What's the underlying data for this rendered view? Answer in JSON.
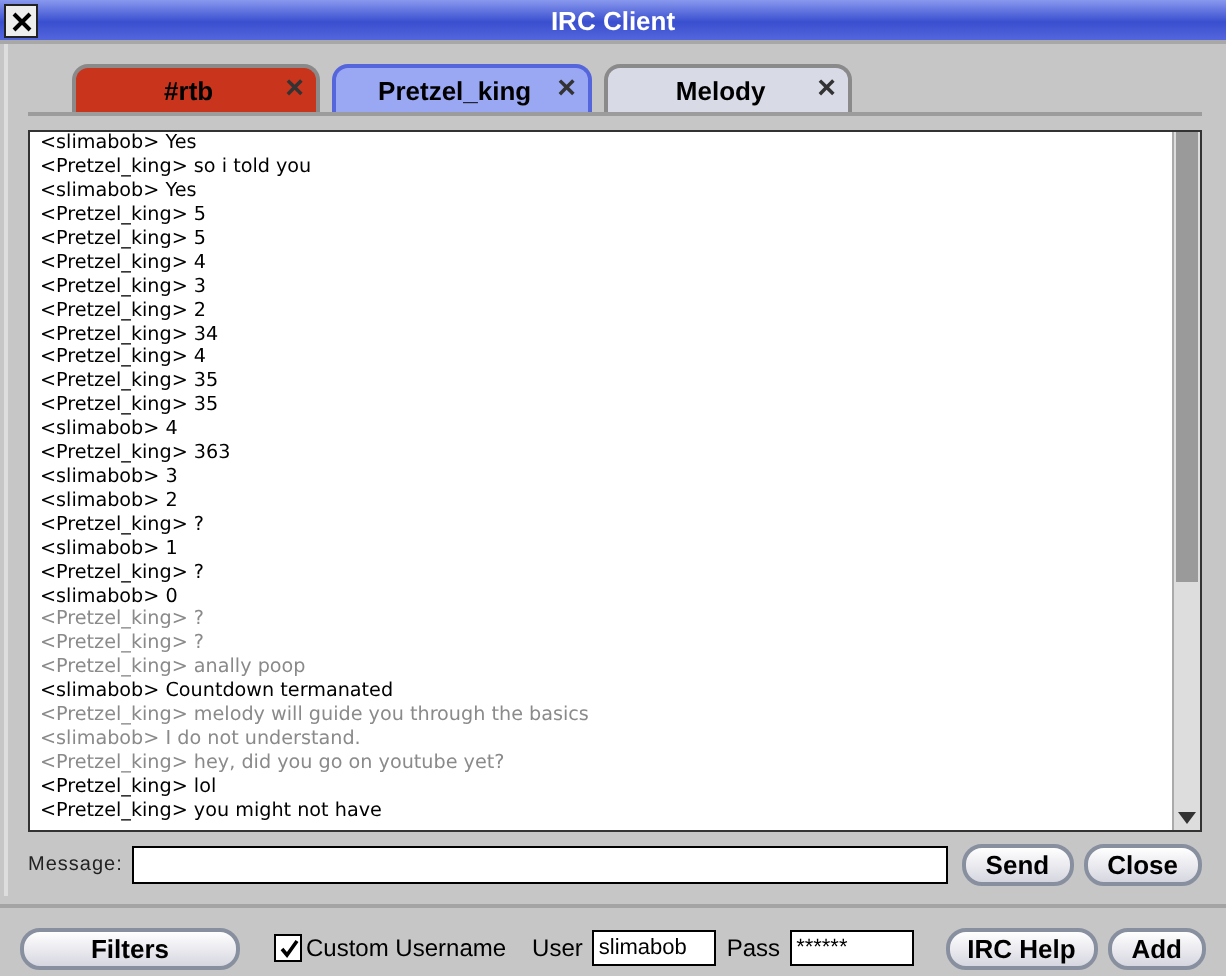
{
  "window": {
    "title": "IRC Client"
  },
  "tabs": [
    {
      "label": "#rtb",
      "close": "×",
      "selected": false,
      "color": "#c8341c"
    },
    {
      "label": "Pretzel_king",
      "close": "×",
      "selected": true,
      "color": "#9aa8f4"
    },
    {
      "label": "Melody",
      "close": "×",
      "selected": false,
      "color": "#d8dae6"
    }
  ],
  "log": [
    {
      "text": "<slimabob> Yes",
      "dimmed": false
    },
    {
      "text": "<Pretzel_king> so i told you",
      "dimmed": false
    },
    {
      "text": "<slimabob> Yes",
      "dimmed": false
    },
    {
      "text": "<Pretzel_king> 5",
      "dimmed": false
    },
    {
      "text": "<Pretzel_king> 5",
      "dimmed": false
    },
    {
      "text": "<Pretzel_king> 4",
      "dimmed": false
    },
    {
      "text": "<Pretzel_king> 3",
      "dimmed": false
    },
    {
      "text": "<Pretzel_king> 2",
      "dimmed": false
    },
    {
      "text": "<Pretzel_king> 34",
      "dimmed": false
    },
    {
      "text": "<Pretzel_king> 4",
      "dimmed": false
    },
    {
      "text": "<Pretzel_king> 35",
      "dimmed": false
    },
    {
      "text": "<Pretzel_king> 35",
      "dimmed": false
    },
    {
      "text": "<slimabob> 4",
      "dimmed": false
    },
    {
      "text": "<Pretzel_king> 363",
      "dimmed": false
    },
    {
      "text": "<slimabob> 3",
      "dimmed": false
    },
    {
      "text": "<slimabob> 2",
      "dimmed": false
    },
    {
      "text": "<Pretzel_king> ?",
      "dimmed": false
    },
    {
      "text": "<slimabob> 1",
      "dimmed": false
    },
    {
      "text": "<Pretzel_king> ?",
      "dimmed": false
    },
    {
      "text": "<slimabob> 0",
      "dimmed": false
    },
    {
      "text": "<Pretzel_king> ?",
      "dimmed": true
    },
    {
      "text": "<Pretzel_king> ?",
      "dimmed": true
    },
    {
      "text": "<Pretzel_king> anally poop",
      "dimmed": true
    },
    {
      "text": "<slimabob> Countdown termanated",
      "dimmed": false
    },
    {
      "text": "<Pretzel_king> melody will guide you through the basics",
      "dimmed": true
    },
    {
      "text": "<slimabob> I do not understand.",
      "dimmed": true
    },
    {
      "text": "<Pretzel_king> hey, did you go on youtube yet?",
      "dimmed": true
    },
    {
      "text": "<Pretzel_king> lol",
      "dimmed": false
    },
    {
      "text": "<Pretzel_king> you might not have",
      "dimmed": false
    }
  ],
  "message": {
    "label": "Message:",
    "send": "Send",
    "close": "Close"
  },
  "bottom": {
    "filters": "Filters",
    "custom_username": {
      "label": "Custom Username",
      "checked": true
    },
    "user_label": "User",
    "user": "slimabob",
    "pass_label": "Pass",
    "pass": "******",
    "help": "IRC Help",
    "add": "Add"
  }
}
